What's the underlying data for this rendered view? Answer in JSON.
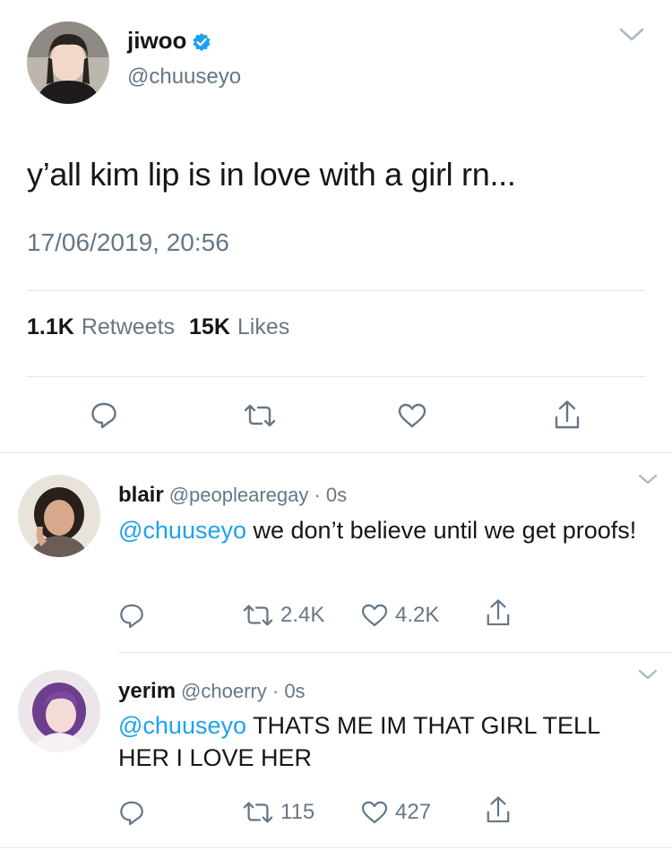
{
  "tweet": {
    "name": "jiwoo",
    "handle": "@chuuseyo",
    "text": "y’all kim lip is in love with a girl rn...",
    "timestamp": "17/06/2019, 20:56",
    "retweet_count": "1.1K",
    "retweets_label": "Retweets",
    "like_count": "15K",
    "likes_label": "Likes"
  },
  "replies": [
    {
      "name": "blair",
      "handle": "@peoplearegay",
      "time": "· 0s",
      "mention": "@chuuseyo",
      "text": " we don’t believe until we get proofs!",
      "retweets": "2.4K",
      "likes": "4.2K"
    },
    {
      "name": "yerim",
      "handle": "@choerry",
      "time": "· 0s",
      "mention": "@chuuseyo",
      "text": " THATS ME IM THAT GIRL TELL HER I LOVE HER",
      "retweets": "115",
      "likes": "427"
    }
  ],
  "icons": {
    "reply": "speech-bubble-icon",
    "retweet": "retweet-arrows-icon",
    "like": "heart-icon",
    "share": "share-upload-icon",
    "verified": "verified-badge-icon",
    "more": "chevron-down-icon"
  },
  "colors": {
    "accent": "#1da1f2",
    "text": "#14171a",
    "secondary": "#657786",
    "divider": "#e1e8ed"
  }
}
